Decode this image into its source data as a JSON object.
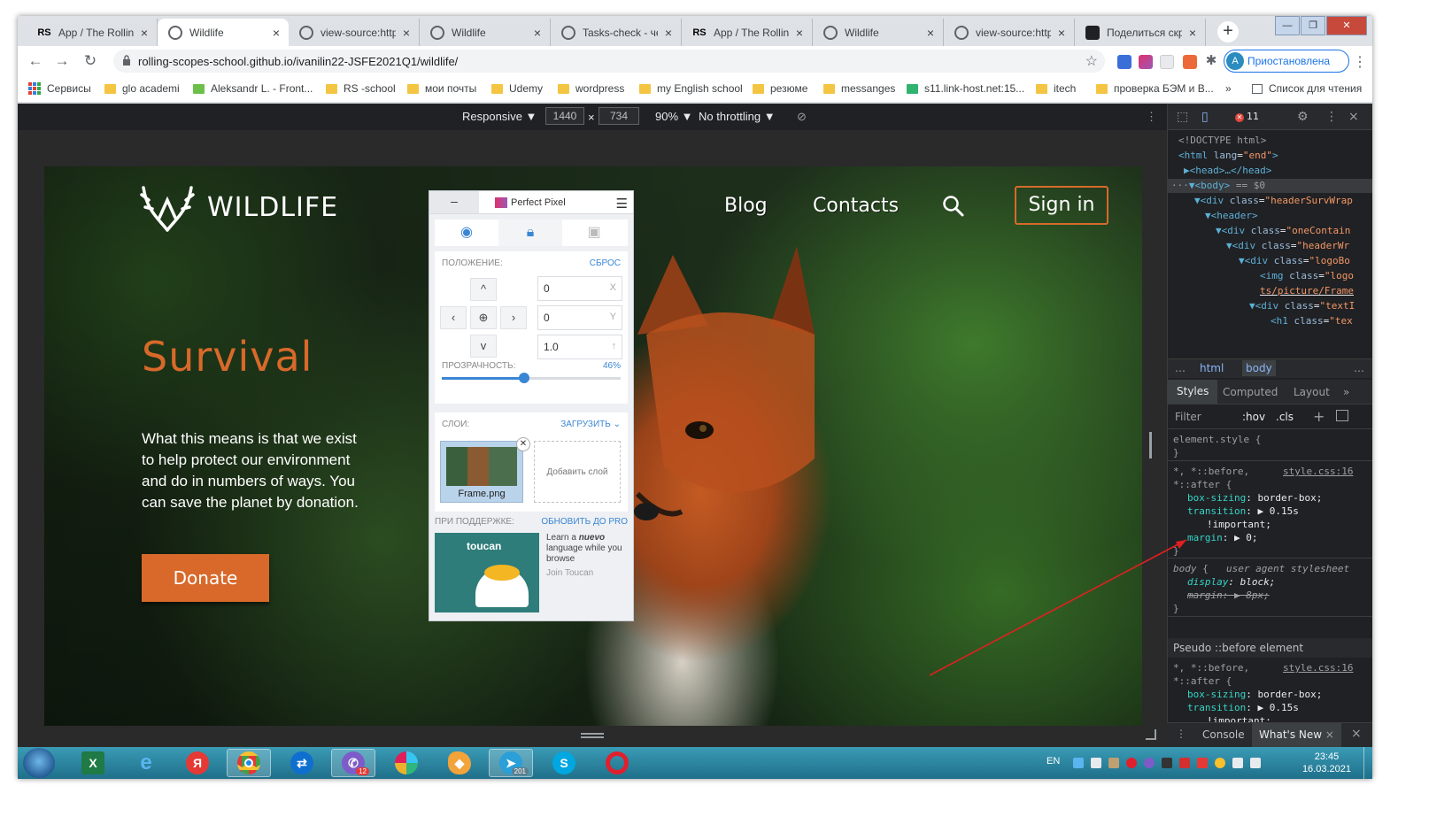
{
  "browser": {
    "tabs": [
      {
        "title": "App / The Rolling",
        "icon": "rs-icon",
        "active": false
      },
      {
        "title": "Wildlife",
        "icon": "globe-icon",
        "active": true
      },
      {
        "title": "view-source:http",
        "icon": "globe-icon",
        "active": false
      },
      {
        "title": "Wildlife",
        "icon": "globe-icon",
        "active": false
      },
      {
        "title": "Tasks-check - че",
        "icon": "globe-icon",
        "active": false
      },
      {
        "title": "App / The Rolling",
        "icon": "rs-icon",
        "active": false
      },
      {
        "title": "Wildlife",
        "icon": "globe-icon",
        "active": false
      },
      {
        "title": "view-source:http",
        "icon": "globe-icon",
        "active": false
      },
      {
        "title": "Поделиться скр",
        "icon": "camera-icon",
        "active": false
      }
    ],
    "tab_close": "×",
    "new_tab": "+",
    "url": "rolling-scopes-school.github.io/ivanilin22-JSFE2021Q1/wildlife/",
    "profile_letter": "A",
    "profile_status": "Приостановлена",
    "bookmarks": [
      "Сервисы",
      "glo academi",
      "Aleksandr L. - Front...",
      "RS -school",
      "мои почты",
      "Udemy",
      "wordpress",
      "my English school",
      "резюме",
      "messanges",
      "s11.link-host.net:15...",
      "itech",
      "проверка БЭМ и В..."
    ],
    "bookmarks_more": "»",
    "reading_list": "Список для чтения"
  },
  "device_toolbar": {
    "mode": "Responsive ▼",
    "width": "1440",
    "times": "×",
    "height": "734",
    "zoom": "90% ▼",
    "throttling": "No throttling ▼"
  },
  "site": {
    "logo_text": "WILDLIFE",
    "nav": [
      "Blog",
      "Contacts"
    ],
    "signin": "Sign in",
    "headline": "Survival",
    "body": "What this means is that we exist to help protect our environment and do in numbers of ways. You can save the planet by donation.",
    "donate": "Donate",
    "colors": {
      "accent": "#d8692a"
    }
  },
  "perfect_pixel": {
    "min": "–",
    "title": "Perfect Pixel",
    "position_label": "ПОЛОЖЕНИЕ:",
    "reset": "СБРОС",
    "x_value": "0",
    "x_suffix": "X",
    "y_value": "0",
    "y_suffix": "Y",
    "scale_value": "1.0",
    "scale_suffix": "↑",
    "opacity_label": "ПРОЗРАЧНОСТЬ:",
    "opacity_value": "46%",
    "opacity_fraction": 0.46,
    "layers_label": "СЛОИ:",
    "upload": "ЗАГРУЗИТЬ",
    "layer_name": "Frame.png",
    "add_layer": "Добавить слой",
    "support_label": "ПРИ ПОДДЕРЖКЕ:",
    "upgrade": "ОБНОВИТЬ ДО PRO",
    "ad_brand": "toucan",
    "ad_text_1": "Learn a",
    "ad_text_em": "nuevo",
    "ad_text_2": "language while you browse",
    "ad_cta": "Join Toucan",
    "arrows": {
      "up": "^",
      "left": "‹",
      "center": "⊕",
      "right": "›",
      "down": "v"
    }
  },
  "devtools": {
    "error_count": "11",
    "dom": [
      {
        "tag": "<!DOCTYPE html>"
      },
      {
        "tag": "<html",
        "attr": "lang",
        "val": "\"end\"",
        "close": ">"
      },
      {
        "tag": "▶<head>…</head>"
      },
      {
        "tag": "▼<body>",
        "extra": "== $0"
      },
      {
        "tag": "▼<div",
        "attr": "class",
        "val": "\"headerSurvWrap"
      },
      {
        "tag": "▼<header>"
      },
      {
        "tag": "▼<div",
        "attr": "class",
        "val": "\"oneContain"
      },
      {
        "tag": "▼<div",
        "attr": "class",
        "val": "\"headerWr"
      },
      {
        "tag": "▼<div",
        "attr": "class",
        "val": "\"logoBo"
      },
      {
        "tag": "<img",
        "attr": "class",
        "val": "\"logo"
      },
      {
        "tag": "ts/picture/Frame"
      },
      {
        "tag": "▼<div",
        "attr": "class",
        "val": "\"textI"
      },
      {
        "tag": "<h1",
        "attr": "class",
        "val": "\"tex"
      }
    ],
    "dom_prefix": "···",
    "crumbs": [
      "html",
      "body"
    ],
    "crumbs_more": "…",
    "style_tabs": [
      "Styles",
      "Computed",
      "Layout"
    ],
    "style_tabs_more": "»",
    "filter": "Filter",
    "hov": ":hov",
    "cls": ".cls",
    "plus": "+",
    "element_style": "element.style {",
    "close_brace": "}",
    "rule1_selector": "*, *::before,",
    "rule1_selector2": "*::after {",
    "rule1_source": "style.css:16",
    "rule1_props": [
      {
        "name": "box-sizing",
        "value": "border-box;"
      },
      {
        "name": "transition",
        "value": "▶ 0.15s"
      }
    ],
    "important": "!important;",
    "margin_prop": "margin",
    "margin_val": "▶ 0;",
    "body_selector": "body",
    "ua_label": "user agent stylesheet",
    "body_display": "display",
    "body_display_val": "block;",
    "body_margin": "margin",
    "body_margin_val": "▶ 8px;",
    "pseudo_label": "Pseudo ::before element",
    "drawer_console": "Console",
    "drawer_new": "What's New",
    "drawer_close": "×",
    "panel_close": "×"
  },
  "taskbar": {
    "language": "EN",
    "time": "23:45",
    "date": "16.03.2021",
    "telegram_badge": "201",
    "viber_badge": "12"
  }
}
